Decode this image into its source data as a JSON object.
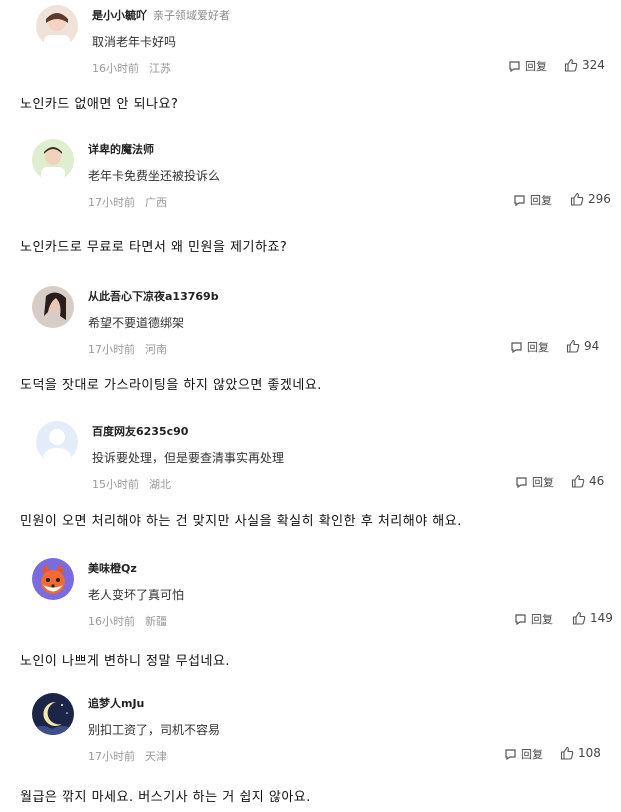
{
  "comments": [
    {
      "user": "是小小毓吖",
      "tag": "亲子领域爱好者",
      "text": "取消老年卡好吗",
      "time": "16小时前",
      "location": "江苏",
      "reply": "回复",
      "likes": "324",
      "avatar_color": "#e8d5c8"
    },
    {
      "user": "详卑的魔法师",
      "tag": "",
      "text": "老年卡免费坐还被投诉么",
      "time": "17小时前",
      "location": "广西",
      "reply": "回复",
      "likes": "296",
      "avatar_color": "#cfe3c2"
    },
    {
      "user": "从此吾心下凉夜a13769b",
      "tag": "",
      "text": "希望不要道德绑架",
      "time": "17小时前",
      "location": "河南",
      "reply": "回复",
      "likes": "94",
      "avatar_color": "#d9c7c2"
    },
    {
      "user": "百度网友6235c90",
      "tag": "",
      "text": "投诉要处理，但是要查清事实再处理",
      "time": "15小时前",
      "location": "湖北",
      "reply": "回复",
      "likes": "46",
      "avatar_color": "#dbe7f7"
    },
    {
      "user": "美味橙Qz",
      "tag": "",
      "text": "老人变坏了真可怕",
      "time": "16小时前",
      "location": "新疆",
      "reply": "回复",
      "likes": "149",
      "avatar_color": "#7a6ad6"
    },
    {
      "user": "追梦人mJu",
      "tag": "",
      "text": "别扣工资了，司机不容易",
      "time": "17小时前",
      "location": "天津",
      "reply": "回复",
      "likes": "108",
      "avatar_color": "#1f2a4d"
    }
  ],
  "translations": [
    "노인카드 없애면 안 되나요?",
    "노인카드로 무료로 타면서 왜 민원을 제기하죠?",
    "도덕을 잣대로 가스라이팅을 하지 않았으면 좋겠네요.",
    "민원이 오면 처리해야 하는 건 맞지만 사실을 확실히 확인한 후 처리해야 해요.",
    "노인이 나쁘게 변하니 정말 무섭네요.",
    "월급은 깎지 마세요. 버스기사 하는 거 쉽지 않아요."
  ]
}
